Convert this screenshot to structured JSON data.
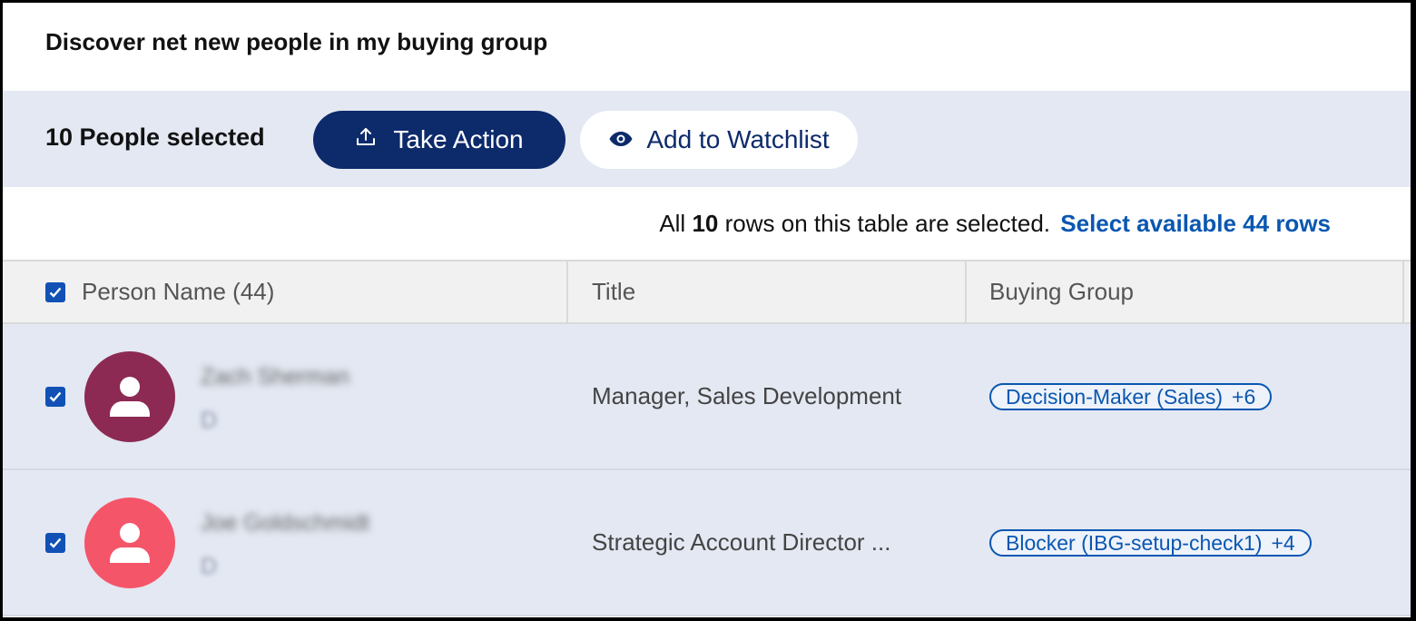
{
  "heading": "Discover net new people in my buying group",
  "toolbar": {
    "selected_label": "10 People selected",
    "take_action": "Take Action",
    "add_watchlist": "Add to Watchlist"
  },
  "notice": {
    "prefix": "All",
    "count": "10",
    "suffix": "rows on this table are selected.",
    "link": "Select available 44 rows"
  },
  "table": {
    "columns": [
      "Person Name (44)",
      "Title",
      "Buying Group"
    ],
    "rows": [
      {
        "name": "Zach Sherman",
        "sub": "D",
        "avatar_color": "#8c2a53",
        "title": "Manager, Sales Development",
        "group": "Decision-Maker (Sales)",
        "more": "+6"
      },
      {
        "name": "Joe Goldschmidt",
        "sub": "D",
        "avatar_color": "#f45569",
        "title": "Strategic Account Director ...",
        "group": "Blocker (IBG-setup-check1)",
        "more": "+4"
      }
    ]
  },
  "colors": {
    "primary": "#0d2a6b",
    "link": "#0a57b0",
    "checkbox": "#1151b5",
    "selected_row_bg": "#e3e8f2"
  },
  "icons": {
    "take_action": "upload-icon",
    "watchlist": "eye-icon",
    "avatar": "person-icon",
    "checkbox": "checkmark-icon"
  }
}
